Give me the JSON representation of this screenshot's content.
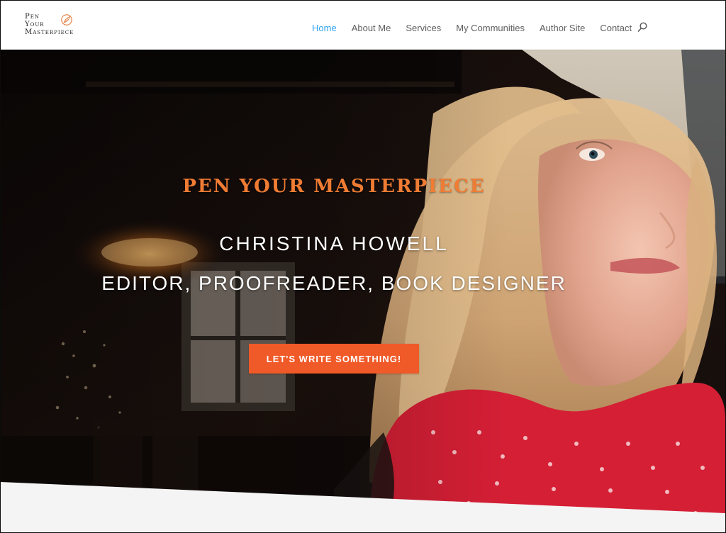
{
  "brand": {
    "logo_lines": [
      "Pen",
      "Your",
      "Masterpiece"
    ]
  },
  "nav": {
    "items": [
      {
        "label": "Home",
        "active": true
      },
      {
        "label": "About Me",
        "active": false
      },
      {
        "label": "Services",
        "active": false
      },
      {
        "label": "My Communities",
        "active": false
      },
      {
        "label": "Author Site",
        "active": false
      },
      {
        "label": "Contact",
        "active": false
      }
    ],
    "search_icon": "search-icon"
  },
  "hero": {
    "kicker": "PEN YOUR MASTERPIECE",
    "name": "CHRISTINA HOWELL",
    "role": "EDITOR, PROOFREADER, BOOK DESIGNER",
    "cta_label": "LET'S WRITE SOMETHING!"
  },
  "colors": {
    "nav_active": "#2ea3f2",
    "nav_text": "#5f5f5f",
    "kicker": "#f07c34",
    "cta": "#f05a28",
    "hero_text": "#ffffff",
    "bottom_band": "#f4f4f4"
  }
}
